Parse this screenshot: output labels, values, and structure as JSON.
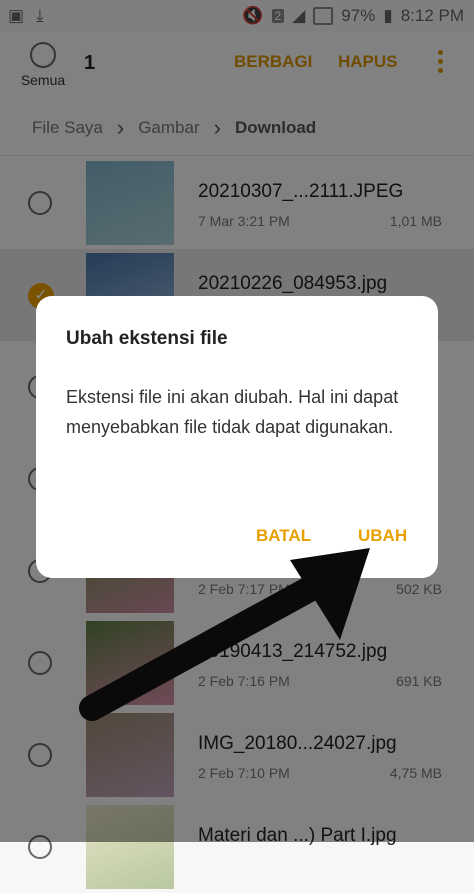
{
  "status_bar": {
    "battery": "97%",
    "time": "8:12 PM",
    "sim_badge": "2",
    "icons": [
      "image-icon",
      "download-icon",
      "mute-icon",
      "signal-icon",
      "battery-icon"
    ]
  },
  "toolbar": {
    "select_all_label": "Semua",
    "selected_count": "1",
    "share_label": "BERBAGI",
    "delete_label": "HAPUS"
  },
  "breadcrumb": [
    "File Saya",
    "Gambar",
    "Download"
  ],
  "files": [
    {
      "name": "20210307_...2111.JPEG",
      "date": "7 Mar 3:21 PM",
      "size": "1,01 MB",
      "selected": false,
      "thumb_colors": [
        "#7fb2c8",
        "#a9cfd6"
      ]
    },
    {
      "name": "20210226_084953.jpg",
      "date": "",
      "size": "",
      "selected": true,
      "thumb_colors": [
        "#4a76a8",
        "#9bb9d8"
      ]
    },
    {
      "name": "",
      "date": "",
      "size": "",
      "selected": false,
      "thumb_colors": [
        "#c9a98c",
        "#e0cbb6"
      ]
    },
    {
      "name": "",
      "date": "",
      "size": "",
      "selected": false,
      "thumb_colors": [
        "#8a9a6a",
        "#b8c09a"
      ]
    },
    {
      "name": "",
      "date": "2 Feb 7:17 PM",
      "size": "502 KB",
      "selected": false,
      "thumb_colors": [
        "#6f8f4e",
        "#c98aa0"
      ]
    },
    {
      "name": "20190413_214752.jpg",
      "date": "2 Feb 7:16 PM",
      "size": "691 KB",
      "selected": false,
      "thumb_colors": [
        "#5f7f45",
        "#d88fa8"
      ]
    },
    {
      "name": "IMG_20180...24027.jpg",
      "date": "2 Feb 7:10 PM",
      "size": "4,75 MB",
      "selected": false,
      "thumb_colors": [
        "#9b8a70",
        "#c0a0b8"
      ]
    },
    {
      "name": "Materi dan ...) Part I.jpg",
      "date": "",
      "size": "",
      "selected": false,
      "thumb_colors": [
        "#e8e4c8",
        "#b8c8a0"
      ]
    }
  ],
  "dialog": {
    "title": "Ubah ekstensi file",
    "message": "Ekstensi file ini akan diubah. Hal ini dapat menyebabkan file tidak dapat digunakan.",
    "cancel_label": "BATAL",
    "confirm_label": "UBAH"
  },
  "colors": {
    "accent": "#e8a000",
    "toolbar_accent": "#d99200"
  }
}
